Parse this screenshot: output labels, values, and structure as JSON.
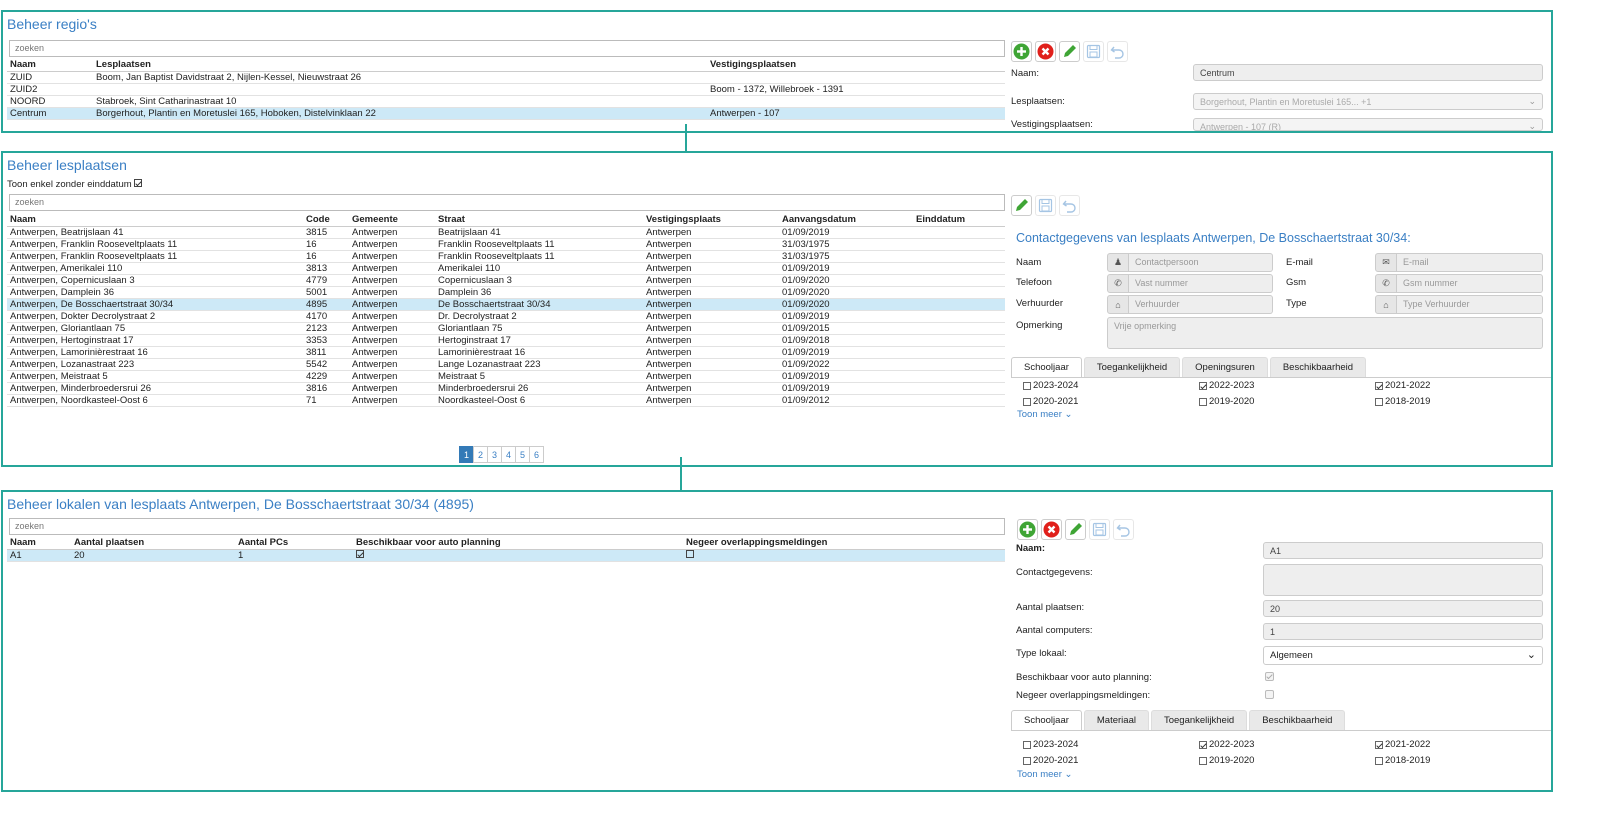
{
  "regios": {
    "title": "Beheer regio's",
    "search_placeholder": "zoeken",
    "columns": [
      "Naam",
      "Lesplaatsen",
      "Vestigingsplaatsen"
    ],
    "rows": [
      [
        "ZUID",
        "Boom, Jan Baptist Davidstraat 2, Nijlen-Kessel, Nieuwstraat 26",
        ""
      ],
      [
        "ZUID2",
        "",
        "Boom - 1372, Willebroek - 1391"
      ],
      [
        "NOORD",
        "Stabroek, Sint Catharinastraat 10",
        ""
      ],
      [
        "Centrum",
        "Borgerhout, Plantin en Moretuslei 165, Hoboken, Distelvinklaan 22",
        "Antwerpen - 107"
      ]
    ],
    "form": {
      "naam_label": "Naam:",
      "naam_value": "Centrum",
      "lesplaatsen_label": "Lesplaatsen:",
      "lesplaatsen_value": "Borgerhout, Plantin en Moretuslei 165... +1",
      "vestigingsplaatsen_label": "Vestigingsplaatsen:",
      "vestigingsplaatsen_value": "Antwerpen - 107 (R)"
    }
  },
  "lesplaatsen": {
    "title": "Beheer lesplaatsen",
    "filter_label": "Toon enkel zonder einddatum",
    "search_placeholder": "zoeken",
    "columns": [
      "Naam",
      "Code",
      "Gemeente",
      "Straat",
      "Vestigingsplaats",
      "Aanvangsdatum",
      "Einddatum"
    ],
    "rows": [
      [
        "Antwerpen, Beatrijslaan 41",
        "3815",
        "Antwerpen",
        "Beatrijslaan 41",
        "Antwerpen",
        "01/09/2019",
        ""
      ],
      [
        "Antwerpen, Franklin Rooseveltplaats 11",
        "16",
        "Antwerpen",
        "Franklin Rooseveltplaats 11",
        "Antwerpen",
        "31/03/1975",
        ""
      ],
      [
        "Antwerpen, Franklin Rooseveltplaats 11",
        "16",
        "Antwerpen",
        "Franklin Rooseveltplaats 11",
        "Antwerpen",
        "31/03/1975",
        ""
      ],
      [
        "Antwerpen, Amerikalei 110",
        "3813",
        "Antwerpen",
        "Amerikalei 110",
        "Antwerpen",
        "01/09/2019",
        ""
      ],
      [
        "Antwerpen, Copernicuslaan 3",
        "4779",
        "Antwerpen",
        "Copernicuslaan 3",
        "Antwerpen",
        "01/09/2020",
        ""
      ],
      [
        "Antwerpen, Damplein 36",
        "5001",
        "Antwerpen",
        "Damplein 36",
        "Antwerpen",
        "01/09/2020",
        ""
      ],
      [
        "Antwerpen, De Bosschaertstraat 30/34",
        "4895",
        "Antwerpen",
        "De Bosschaertstraat 30/34",
        "Antwerpen",
        "01/09/2020",
        ""
      ],
      [
        "Antwerpen, Dokter Decrolystraat 2",
        "4170",
        "Antwerpen",
        "Dr. Decrolystraat 2",
        "Antwerpen",
        "01/09/2019",
        ""
      ],
      [
        "Antwerpen, Gloriantlaan 75",
        "2123",
        "Antwerpen",
        "Gloriantlaan 75",
        "Antwerpen",
        "01/09/2015",
        ""
      ],
      [
        "Antwerpen, Hertoginstraat 17",
        "3353",
        "Antwerpen",
        "Hertoginstraat 17",
        "Antwerpen",
        "01/09/2018",
        ""
      ],
      [
        "Antwerpen, Lamorinièrestraat 16",
        "3811",
        "Antwerpen",
        "Lamorinièrestraat 16",
        "Antwerpen",
        "01/09/2019",
        ""
      ],
      [
        "Antwerpen, Lozanastraat 223",
        "5542",
        "Antwerpen",
        "Lange Lozanastraat 223",
        "Antwerpen",
        "01/09/2022",
        ""
      ],
      [
        "Antwerpen, Meistraat 5",
        "4229",
        "Antwerpen",
        "Meistraat 5",
        "Antwerpen",
        "01/09/2019",
        ""
      ],
      [
        "Antwerpen, Minderbroedersrui 26",
        "3816",
        "Antwerpen",
        "Minderbroedersrui 26",
        "Antwerpen",
        "01/09/2019",
        ""
      ],
      [
        "Antwerpen, Noordkasteel-Oost 6",
        "71",
        "Antwerpen",
        "Noordkasteel-Oost 6",
        "Antwerpen",
        "01/09/2012",
        ""
      ]
    ],
    "pages": [
      "1",
      "2",
      "3",
      "4",
      "5",
      "6"
    ],
    "contact": {
      "title": "Contactgegevens van lesplaats Antwerpen, De Bosschaertstraat 30/34:",
      "naam_label": "Naam",
      "naam_placeholder": "Contactpersoon",
      "email_label": "E-mail",
      "email_placeholder": "E-mail",
      "telefoon_label": "Telefoon",
      "telefoon_placeholder": "Vast nummer",
      "gsm_label": "Gsm",
      "gsm_placeholder": "Gsm nummer",
      "verhuurder_label": "Verhuurder",
      "verhuurder_placeholder": "Verhuurder",
      "type_label": "Type",
      "type_placeholder": "Type Verhuurder",
      "opmerking_label": "Opmerking",
      "opmerking_placeholder": "Vrije opmerking"
    },
    "tabs": [
      "Schooljaar",
      "Toegankelijkheid",
      "Openingsuren",
      "Beschikbaarheid"
    ],
    "years": [
      {
        "label": "2023-2024",
        "checked": false
      },
      {
        "label": "2022-2023",
        "checked": true
      },
      {
        "label": "2021-2022",
        "checked": true
      },
      {
        "label": "2020-2021",
        "checked": false
      },
      {
        "label": "2019-2020",
        "checked": false
      },
      {
        "label": "2018-2019",
        "checked": false
      }
    ],
    "more_label": "Toon meer"
  },
  "lokalen": {
    "title": "Beheer lokalen van lesplaats Antwerpen, De Bosschaertstraat 30/34 (4895)",
    "search_placeholder": "zoeken",
    "columns": [
      "Naam",
      "Aantal plaatsen",
      "Aantal PCs",
      "Beschikbaar voor auto planning",
      "Negeer overlappingsmeldingen"
    ],
    "rows": [
      {
        "naam": "A1",
        "plaatsen": "20",
        "pcs": "1",
        "auto": true,
        "negeer": false
      }
    ],
    "form": {
      "naam_label": "Naam:",
      "naam_value": "A1",
      "contact_label": "Contactgegevens:",
      "plaatsen_label": "Aantal plaatsen:",
      "plaatsen_value": "20",
      "computers_label": "Aantal computers:",
      "computers_value": "1",
      "type_label": "Type lokaal:",
      "type_value": "Algemeen",
      "auto_label": "Beschikbaar voor auto planning:",
      "negeer_label": "Negeer overlappingsmeldingen:"
    },
    "tabs": [
      "Schooljaar",
      "Materiaal",
      "Toegankelijkheid",
      "Beschikbaarheid"
    ],
    "years": [
      {
        "label": "2023-2024",
        "checked": false
      },
      {
        "label": "2022-2023",
        "checked": true
      },
      {
        "label": "2021-2022",
        "checked": true
      },
      {
        "label": "2020-2021",
        "checked": false
      },
      {
        "label": "2019-2020",
        "checked": false
      },
      {
        "label": "2018-2019",
        "checked": false
      }
    ],
    "more_label": "Toon meer"
  },
  "colors": {
    "frame": "#26a69a",
    "title": "#3a7fc4",
    "selected_row": "#cde9f7",
    "add": "#3fa535",
    "delete": "#e0201b",
    "edit": "#3fa535"
  }
}
